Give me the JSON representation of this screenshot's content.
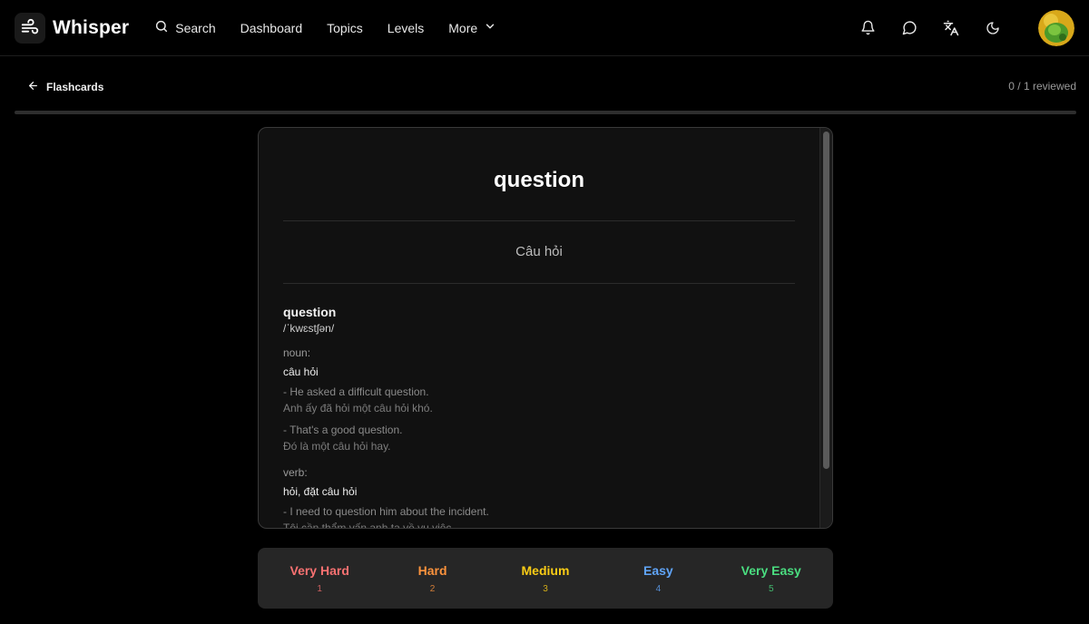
{
  "app": {
    "name": "Whisper"
  },
  "nav": {
    "search": "Search",
    "dashboard": "Dashboard",
    "topics": "Topics",
    "levels": "Levels",
    "more": "More"
  },
  "header_icons": [
    "bell-icon",
    "chat-icon",
    "translate-icon",
    "moon-icon"
  ],
  "subheader": {
    "back_label": "Flashcards",
    "progress_text": "0 / 1 reviewed",
    "progress_fraction": 0
  },
  "card": {
    "word": "question",
    "translation": "Câu hỏi",
    "entry_word": "question",
    "ipa": "/ˈkwɛstʃən/",
    "senses": [
      {
        "pos": "noun:",
        "meaning": "câu hỏi",
        "examples": [
          {
            "en": "- He asked a difficult question.",
            "vi": "Anh ấy đã hỏi một câu hỏi khó."
          },
          {
            "en": "- That's a good question.",
            "vi": "Đó là một câu hỏi hay."
          }
        ]
      },
      {
        "pos": "verb:",
        "meaning": "hỏi, đặt câu hỏi",
        "examples": [
          {
            "en": "- I need to question him about the incident.",
            "vi": "Tôi cần thẩm vấn anh ta về vụ việc."
          }
        ]
      }
    ]
  },
  "ratings": [
    {
      "label": "Very Hard",
      "key": "1",
      "color": "#f87171"
    },
    {
      "label": "Hard",
      "key": "2",
      "color": "#fb923c"
    },
    {
      "label": "Medium",
      "key": "3",
      "color": "#facc15"
    },
    {
      "label": "Easy",
      "key": "4",
      "color": "#60a5fa"
    },
    {
      "label": "Very Easy",
      "key": "5",
      "color": "#4ade80"
    }
  ]
}
